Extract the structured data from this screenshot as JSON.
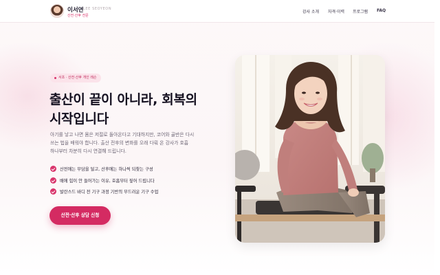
{
  "brand": {
    "name_ko": "이서연",
    "name_en": "LEE SEOYEON",
    "subtitle": "산전·산후 전문"
  },
  "nav": [
    {
      "label": "강사 소개"
    },
    {
      "label": "자격·이력"
    },
    {
      "label": "프로그램"
    },
    {
      "label": "FAQ"
    }
  ],
  "hero": {
    "badge": "서초 · 산전·산후 개인 레슨",
    "title_line1": "출산이 끝이 아니라, 회복의",
    "title_line2": "시작입니다",
    "desc_line1": "아기를 낳고 나면 몸은 저절로 돌아온다고 기대하지만, 코어와 골반은 다시",
    "desc_line2": "쓰는 법을 배워야 합니다. 출산 전후의 변화를 오래 다뤄 온 강사가 호흡",
    "desc_line3": "하나부터 차분히 다시 연결해 드립니다.",
    "features": [
      "산전에는 부담을 덜고, 산후에는 하나씩 되찾는 구성",
      "배에 힘이 안 들어가는 이유, 호흡부터 짚어 드립니다",
      "발란스드 바디 전 기구 과정 기반의 부드러운 기구 수업"
    ],
    "cta": "산전·산후 상담 신청"
  },
  "colors": {
    "accent": "#d42b62",
    "badge_bg": "#fbe3ea",
    "text": "#141020",
    "muted": "#6d6676"
  }
}
